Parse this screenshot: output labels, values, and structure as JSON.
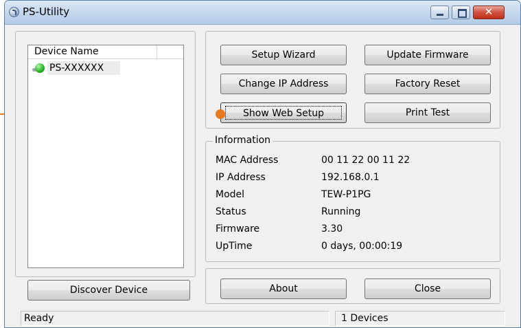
{
  "window": {
    "title": "PS-Utility",
    "controls": {
      "minimize": "minimize",
      "maximize": "maximize",
      "close_glyph": "✕"
    }
  },
  "device_list": {
    "column_header": "Device Name",
    "items": [
      {
        "label": "PS-XXXXXX",
        "status_color": "#2cb62b",
        "icon": "printer-server-online-icon"
      }
    ],
    "discover_button": "Discover Device"
  },
  "actions": {
    "setup_wizard": "Setup Wizard",
    "update_firmware": "Update Firmware",
    "change_ip": "Change IP Address",
    "factory_reset": "Factory Reset",
    "show_web_setup": "Show Web Setup",
    "print_test": "Print Test"
  },
  "information": {
    "legend": "Information",
    "rows": [
      {
        "label": "MAC Address",
        "value": "00 11 22 00 11 22"
      },
      {
        "label": "IP Address",
        "value": "192.168.0.1"
      },
      {
        "label": "Model",
        "value": "TEW-P1PG"
      },
      {
        "label": "Status",
        "value": "Running"
      },
      {
        "label": "Firmware",
        "value": "3.30"
      },
      {
        "label": "UpTime",
        "value": "0 days, 00:00:19"
      }
    ]
  },
  "footer_buttons": {
    "about": "About",
    "close": "Close"
  },
  "statusbar": {
    "state": "Ready",
    "device_count": "1 Devices"
  },
  "colors": {
    "callout": "#e8781d",
    "close_button": "#c1301b",
    "titlebar": "#c2d6ec"
  }
}
